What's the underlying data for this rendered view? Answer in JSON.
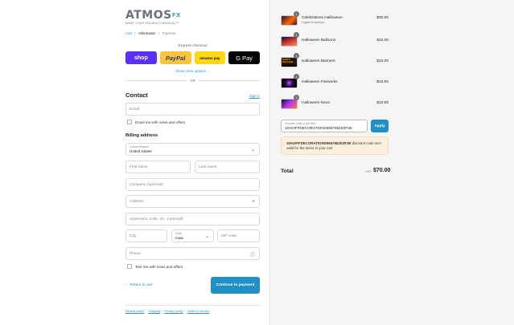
{
  "brand": {
    "name": "ATMOS",
    "suffix": "FX",
    "tagline": "MAKE YOUR HOLIDAYS MAGICAL™"
  },
  "breadcrumb": {
    "cart": "Cart",
    "information": "Information",
    "payment": "Payment",
    "separator": ">"
  },
  "express": {
    "title": "Express checkout",
    "shop_label": "shop",
    "paypal_label": "PayPal",
    "amazon_label": "amazon pay",
    "gpay_label": "G Pay",
    "show_more": "Show more options",
    "or": "OR"
  },
  "contact": {
    "heading": "Contact",
    "signin": "Sign in",
    "email_placeholder": "Email",
    "news_label": "Email me with news and offers"
  },
  "billing": {
    "heading": "Billing address",
    "country_label": "Country/Region",
    "country_value": "United States",
    "first_name": "First name",
    "last_name": "Last name",
    "company": "Company (optional)",
    "address": "Address",
    "apartment": "Apartment, suite, etc. (optional)",
    "city": "City",
    "state_label": "State",
    "state_value": "Iowa",
    "zip": "ZIP code",
    "phone": "Phone",
    "text_label": "Text me with news and offers"
  },
  "actions": {
    "return": "Return to cart",
    "continue": "Continue to payment"
  },
  "footer": {
    "links": [
      "Refund policy",
      "Shipping",
      "Privacy policy",
      "Terms of service"
    ]
  },
  "cart": {
    "items": [
      {
        "qty": "1",
        "name": "Celebrations Halloween",
        "sub": "Digital Download",
        "price": "$30.00"
      },
      {
        "qty": "1",
        "name": "Halloween Balloons",
        "sub": "",
        "price": "$10.00"
      },
      {
        "qty": "1",
        "name": "Halloween Banners",
        "sub": "",
        "price": "$10.00"
      },
      {
        "qty": "1",
        "name": "Halloween Fireworks",
        "sub": "",
        "price": "$10.00"
      },
      {
        "qty": "1",
        "name": "Halloween Neon",
        "sub": "",
        "price": "$10.00"
      }
    ],
    "thumb3_text": "HAPPY HALLOW",
    "discount_label": "Discount code or gift card",
    "discount_value": "15%OFFDECORATIONS9657662D3F3E",
    "apply": "Apply",
    "warning_code": "15%OFFDECORATIONS9657662D3F3E",
    "warning_rest": " discount code isn't valid for the items in your cart",
    "total_label": "Total",
    "currency": "USD",
    "total": "$70.00"
  }
}
